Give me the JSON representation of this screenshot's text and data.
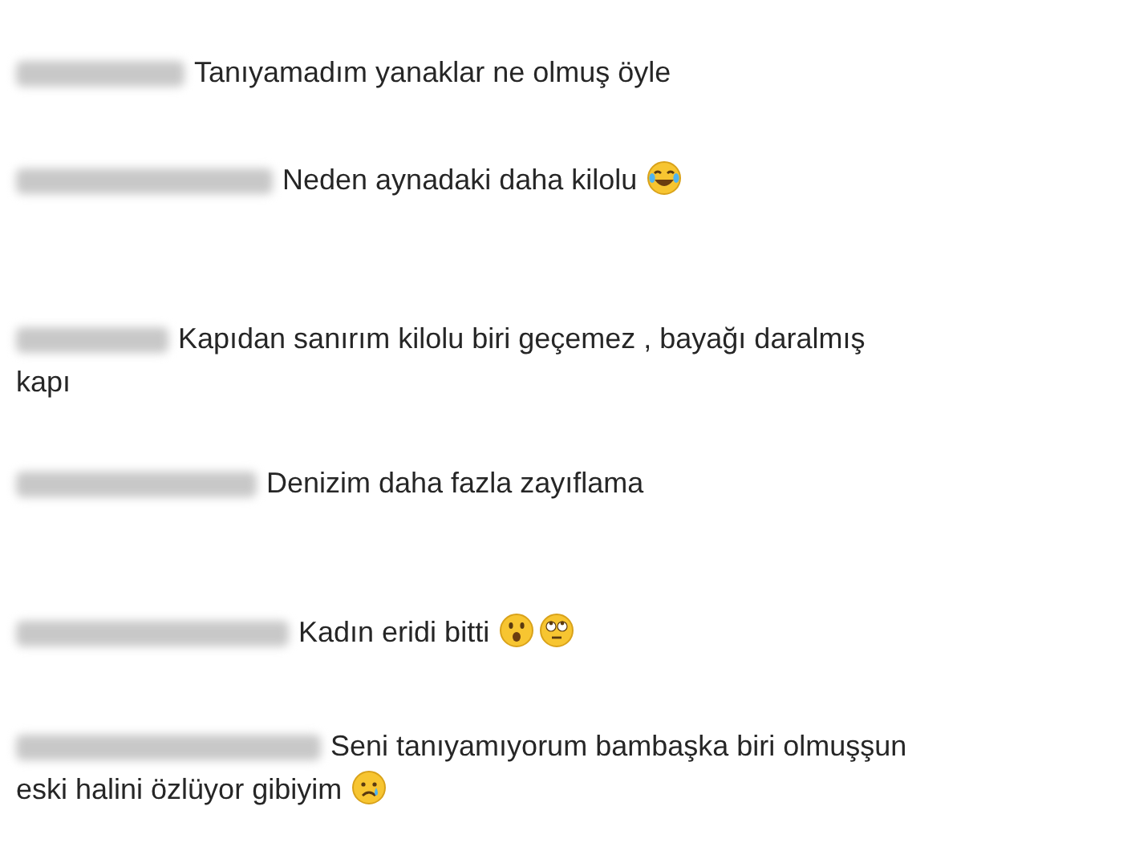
{
  "comments": [
    {
      "lines": [
        "Tanıyamadım yanaklar ne olmuş öyle"
      ]
    },
    {
      "lines": [
        "Neden aynadaki daha kilolu"
      ],
      "icons": [
        {
          "kind": "laughing"
        }
      ]
    },
    {
      "lines": [
        "Kapıdan sanırım kilolu biri geçemez , bayağı daralmış",
        "kapı"
      ]
    },
    {
      "lines": [
        "Denizim daha fazla zayıflama"
      ]
    },
    {
      "lines": [
        "Kadın eridi bitti"
      ],
      "icons": [
        {
          "kind": "surprised"
        },
        {
          "kind": "eyeroll"
        }
      ]
    },
    {
      "lines": [
        "Seni tanıyamıyorum bambaşka biri olmuşşun",
        "eski halini özlüyor gibiyim"
      ],
      "icons": [
        {
          "kind": "crying"
        }
      ]
    }
  ]
}
